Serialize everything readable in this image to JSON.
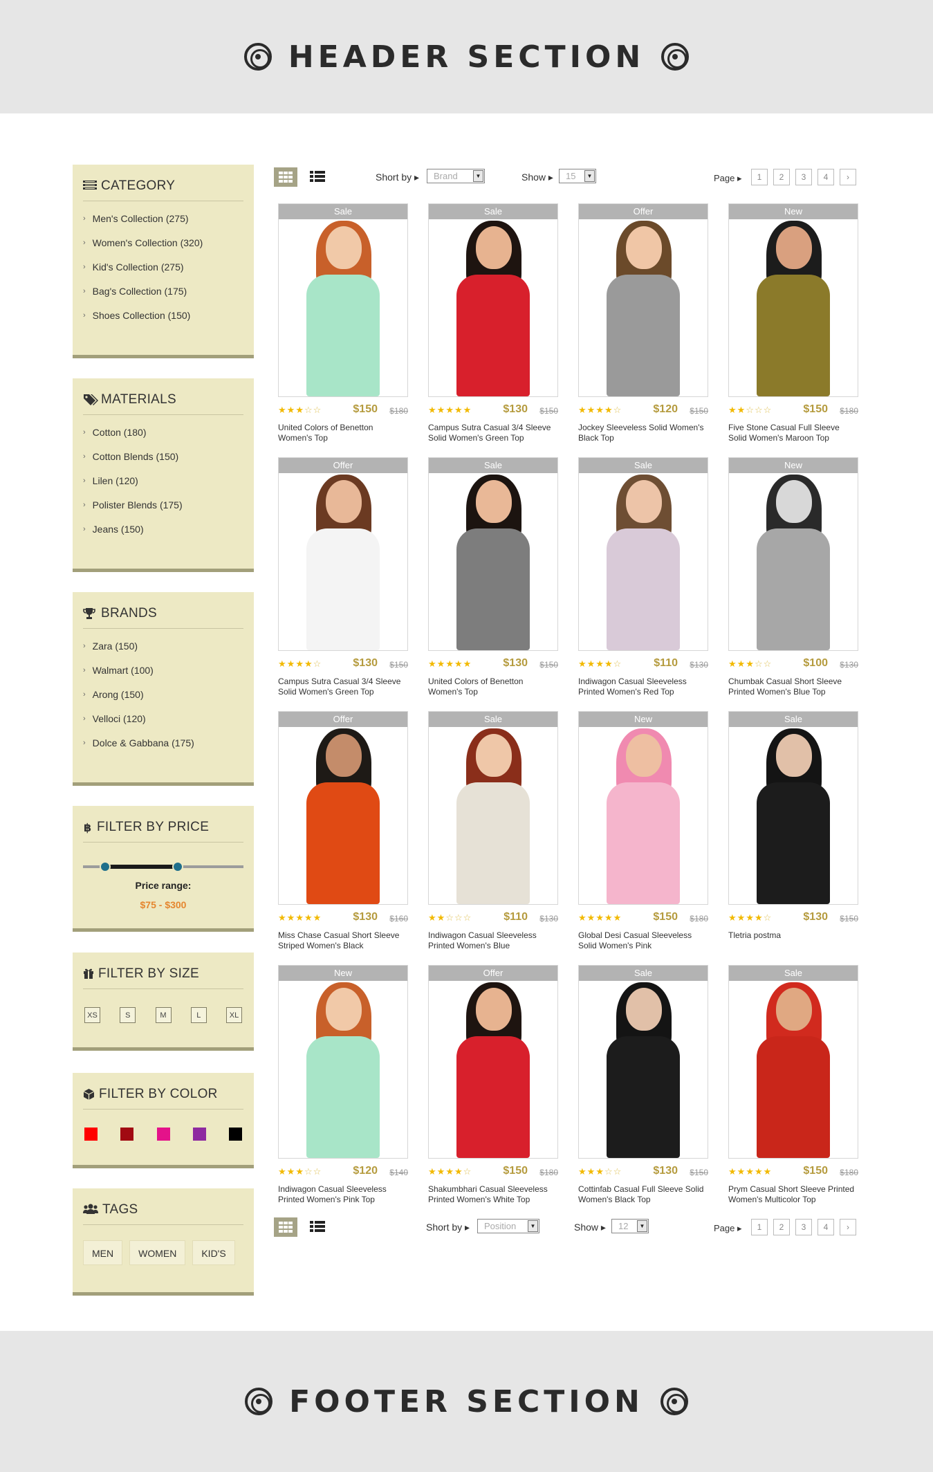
{
  "header": {
    "title": "HEADER SECTION"
  },
  "footer": {
    "title": "FOOTER SECTION"
  },
  "sidebar": {
    "category": {
      "title": "CATEGORY",
      "items": [
        "Men's Collection (275)",
        "Women's Collection (320)",
        "Kid's Collection (275)",
        "Bag's Collection (175)",
        "Shoes Collection (150)"
      ]
    },
    "materials": {
      "title": "MATERIALS",
      "items": [
        "Cotton (180)",
        "Cotton Blends (150)",
        "Lilen (120)",
        "Polister Blends (175)",
        "Jeans (150)"
      ]
    },
    "brands": {
      "title": "BRANDS",
      "items": [
        "Zara (150)",
        "Walmart (100)",
        "Arong (150)",
        "Velloci (120)",
        "Dolce & Gabbana (175)"
      ]
    },
    "price": {
      "title": "FILTER BY PRICE",
      "label": "Price range:",
      "range": "$75 - $300",
      "low_fraction": 0.14,
      "high_fraction": 0.59
    },
    "size": {
      "title": "FILTER BY SIZE",
      "options": [
        "XS",
        "S",
        "M",
        "L",
        "XL"
      ]
    },
    "color": {
      "title": "FILTER BY COLOR",
      "swatches": [
        "#ff0000",
        "#a10a12",
        "#e4128a",
        "#8e2aa0",
        "#000000"
      ]
    },
    "tags": {
      "title": "TAGS",
      "items": [
        "MEN",
        "WOMEN",
        "KID'S"
      ]
    }
  },
  "toolbar_top": {
    "sort_label": "Short by",
    "sort_value": "Brand",
    "show_label": "Show",
    "show_value": "15",
    "page_label": "Page",
    "pages": [
      "1",
      "2",
      "3",
      "4",
      "›"
    ]
  },
  "toolbar_bottom": {
    "sort_label": "Short by",
    "sort_value": "Position",
    "show_label": "Show",
    "show_value": "12",
    "page_label": "Page",
    "pages": [
      "1",
      "2",
      "3",
      "4",
      "›"
    ]
  },
  "products": [
    {
      "badge": "Sale",
      "rating": 3,
      "price": "$150",
      "old_price": "$180",
      "name": "United Colors of Benetton Women's Top",
      "colors": [
        "#f1c9a8",
        "#c8602a",
        "#a8e5c8"
      ]
    },
    {
      "badge": "Sale",
      "rating": 5,
      "price": "$130",
      "old_price": "$150",
      "name": "Campus Sutra Casual 3/4 Sleeve Solid Women's Green Top",
      "colors": [
        "#e7b390",
        "#1e1410",
        "#d8202c"
      ]
    },
    {
      "badge": "Offer",
      "rating": 4,
      "price": "$120",
      "old_price": "$150",
      "name": "Jockey Sleeveless Solid Women's Black Top",
      "colors": [
        "#f0c6a6",
        "#6b4a2a",
        "#9a9a9a"
      ]
    },
    {
      "badge": "New",
      "rating": 2,
      "price": "$150",
      "old_price": "$180",
      "name": "Five Stone Casual Full Sleeve Solid Women's Maroon Top",
      "colors": [
        "#d9a07f",
        "#1c1c1c",
        "#8b7a2a"
      ]
    },
    {
      "badge": "Offer",
      "rating": 4,
      "price": "$130",
      "old_price": "$150",
      "name": "Campus Sutra Casual 3/4 Sleeve Solid Women's Green Top",
      "colors": [
        "#e8b898",
        "#6b3a22",
        "#f4f4f4"
      ]
    },
    {
      "badge": "Sale",
      "rating": 5,
      "price": "$130",
      "old_price": "$150",
      "name": "United Colors of Benetton Women's Top",
      "colors": [
        "#e9b897",
        "#1c1410",
        "#7d7d7d"
      ]
    },
    {
      "badge": "Sale",
      "rating": 4,
      "price": "$110",
      "old_price": "$130",
      "name": "Indiwagon Casual Sleeveless Printed Women's Red Top",
      "colors": [
        "#edc4a8",
        "#6e4e33",
        "#d9cad8"
      ]
    },
    {
      "badge": "New",
      "rating": 3,
      "price": "$100",
      "old_price": "$130",
      "name": "Chumbak Casual Short Sleeve Printed Women's Blue Top",
      "colors": [
        "#d8d8d8",
        "#2a2a2a",
        "#a7a7a7"
      ]
    },
    {
      "badge": "Offer",
      "rating": 5,
      "price": "$130",
      "old_price": "$160",
      "name": "Miss Chase Casual Short Sleeve Striped Women's Black",
      "colors": [
        "#c48c6a",
        "#1e1a16",
        "#e04a14"
      ]
    },
    {
      "badge": "Sale",
      "rating": 2,
      "price": "$110",
      "old_price": "$130",
      "name": "Indiwagon Casual Sleeveless Printed Women's Blue",
      "colors": [
        "#efc7a8",
        "#8a2e1a",
        "#e6e1d6"
      ]
    },
    {
      "badge": "New",
      "rating": 5,
      "price": "$150",
      "old_price": "$180",
      "name": "Global Desi Casual Sleeveless Solid Women's Pink",
      "colors": [
        "#eebfa2",
        "#f08ab0",
        "#f5b5cc"
      ]
    },
    {
      "badge": "Sale",
      "rating": 4,
      "price": "$130",
      "old_price": "$150",
      "name": "Tletria postma",
      "colors": [
        "#e1c0a8",
        "#141414",
        "#1c1c1c"
      ]
    },
    {
      "badge": "New",
      "rating": 3,
      "price": "$120",
      "old_price": "$140",
      "name": "Indiwagon Casual Sleeveless Printed Women's Pink Top",
      "colors": [
        "#f1c9a8",
        "#c8602a",
        "#a8e5c8"
      ]
    },
    {
      "badge": "Offer",
      "rating": 4,
      "price": "$150",
      "old_price": "$180",
      "name": "Shakumbhari Casual Sleeveless Printed Women's White Top",
      "colors": [
        "#e7b390",
        "#1e1410",
        "#d8202c"
      ]
    },
    {
      "badge": "Sale",
      "rating": 3,
      "price": "$130",
      "old_price": "$150",
      "name": "Cottinfab Casual Full Sleeve Solid Women's Black Top",
      "colors": [
        "#e1c0a8",
        "#141414",
        "#1c1c1c"
      ]
    },
    {
      "badge": "Sale",
      "rating": 5,
      "price": "$150",
      "old_price": "$180",
      "name": "Prym Casual Short Sleeve Printed Women's Multicolor Top",
      "colors": [
        "#e0a882",
        "#d12a1e",
        "#c9261a"
      ]
    }
  ]
}
